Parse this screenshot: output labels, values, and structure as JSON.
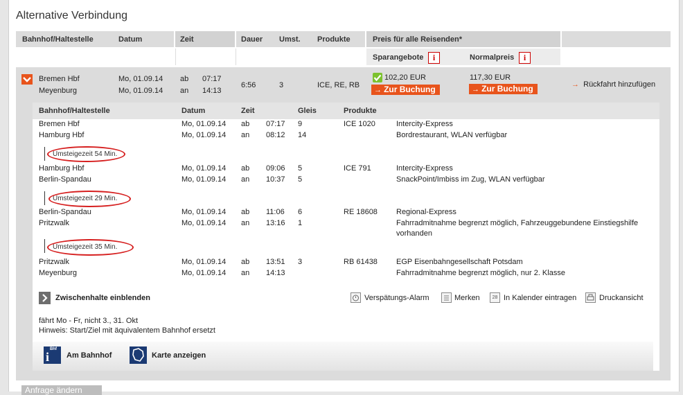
{
  "title": "Alternative Verbindung",
  "columns": {
    "station": "Bahnhof/Haltestelle",
    "date": "Datum",
    "time": "Zeit",
    "duration": "Dauer",
    "changes": "Umst.",
    "products": "Produkte",
    "price_all": "Preis für alle Reisenden*",
    "saver": "Sparangebote",
    "normal": "Normalpreis"
  },
  "info_glyph": "i",
  "connection": {
    "from": "Bremen Hbf",
    "to": "Meyenburg",
    "date_from": "Mo, 01.09.14",
    "date_to": "Mo, 01.09.14",
    "dep_label": "ab",
    "arr_label": "an",
    "dep_time": "07:17",
    "arr_time": "14:13",
    "duration": "6:56",
    "changes": "3",
    "products": "ICE, RE, RB",
    "saver_price": "102,20 EUR",
    "normal_price": "117,30 EUR",
    "book_label": "Zur Buchung",
    "return_label": "Rückfahrt hinzufügen"
  },
  "details_header": {
    "station": "Bahnhof/Haltestelle",
    "date": "Datum",
    "time": "Zeit",
    "platform": "Gleis",
    "products": "Produkte"
  },
  "legs": [
    {
      "dep_station": "Bremen Hbf",
      "dep_date": "Mo, 01.09.14",
      "dep_label": "ab",
      "dep_time": "07:17",
      "dep_platform": "9",
      "train": "ICE 1020",
      "arr_station": "Hamburg Hbf",
      "arr_date": "Mo, 01.09.14",
      "arr_label": "an",
      "arr_time": "08:12",
      "arr_platform": "14",
      "info1": "Intercity-Express",
      "info2": "Bordrestaurant, WLAN verfügbar",
      "info3": ""
    },
    {
      "dep_station": "Hamburg Hbf",
      "dep_date": "Mo, 01.09.14",
      "dep_label": "ab",
      "dep_time": "09:06",
      "dep_platform": "5",
      "train": "ICE 791",
      "arr_station": "Berlin-Spandau",
      "arr_date": "Mo, 01.09.14",
      "arr_label": "an",
      "arr_time": "10:37",
      "arr_platform": "5",
      "info1": "Intercity-Express",
      "info2": "SnackPoint/Imbiss im Zug, WLAN verfügbar",
      "info3": ""
    },
    {
      "dep_station": "Berlin-Spandau",
      "dep_date": "Mo, 01.09.14",
      "dep_label": "ab",
      "dep_time": "11:06",
      "dep_platform": "6",
      "train": "RE 18608",
      "arr_station": "Pritzwalk",
      "arr_date": "Mo, 01.09.14",
      "arr_label": "an",
      "arr_time": "13:16",
      "arr_platform": "1",
      "info1": "Regional-Express",
      "info2": "Fahrradmitnahme begrenzt möglich, Fahrzeuggebundene Einstiegshilfe",
      "info3": "vorhanden"
    },
    {
      "dep_station": "Pritzwalk",
      "dep_date": "Mo, 01.09.14",
      "dep_label": "ab",
      "dep_time": "13:51",
      "dep_platform": "3",
      "train": "RB 61438",
      "arr_station": "Meyenburg",
      "arr_date": "Mo, 01.09.14",
      "arr_label": "an",
      "arr_time": "14:13",
      "arr_platform": "",
      "info1": "EGP Eisenbahngesellschaft Potsdam",
      "info2": "Fahrradmitnahme begrenzt möglich, nur 2. Klasse",
      "info3": ""
    }
  ],
  "transfers": [
    "Umsteigezeit 54 Min.",
    "Umsteigezeit 29 Min.",
    "Umsteigezeit 35 Min."
  ],
  "actions": {
    "show_stops": "Zwischenhalte einblenden",
    "delay_alarm": "Verspätungs-Alarm",
    "remember": "Merken",
    "calendar": "In Kalender eintragen",
    "print": "Druckansicht",
    "calendar_icon_text": "28"
  },
  "notes": {
    "runs": "fährt Mo - Fr, nicht 3., 31. Okt",
    "hint": "Hinweis: Start/Ziel mit äquivalentem Bahnhof ersetzt"
  },
  "bottom_actions": {
    "station": "Am Bahnhof",
    "station_badge": "Bhf",
    "map": "Karte anzeigen"
  },
  "change_request": "Anfrage ändern",
  "colors": {
    "accent": "#e8541c",
    "marker": "#d61f1f",
    "check": "#7cc22e"
  },
  "icons": [
    "collapse-chevron-icon",
    "check-icon",
    "info-icon",
    "arrow-right-icon",
    "chevron-right-icon",
    "alarm-clock-icon",
    "notepad-icon",
    "calendar-icon",
    "printer-icon",
    "station-info-icon",
    "map-icon"
  ]
}
